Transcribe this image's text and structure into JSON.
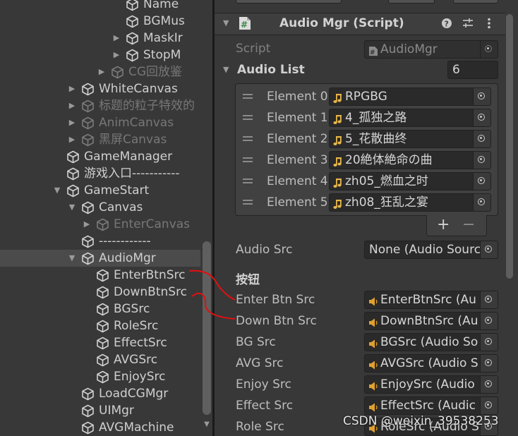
{
  "hierarchy": {
    "items": [
      {
        "label": "Name",
        "depth": 4,
        "arrow": "",
        "dim": false
      },
      {
        "label": "BGMus",
        "depth": 4,
        "arrow": "",
        "dim": false
      },
      {
        "label": "MaskIr",
        "depth": 4,
        "arrow": "right",
        "dim": false
      },
      {
        "label": "StopM",
        "depth": 4,
        "arrow": "right",
        "dim": false
      },
      {
        "label": "CG回放鉴",
        "depth": 3,
        "arrow": "right",
        "dim": true
      },
      {
        "label": "WhiteCanvas",
        "depth": 1,
        "arrow": "right",
        "dim": false
      },
      {
        "label": "标题的粒子特效的",
        "depth": 1,
        "arrow": "right",
        "dim": true
      },
      {
        "label": "AnimCanvas",
        "depth": 1,
        "arrow": "right",
        "dim": true
      },
      {
        "label": "黑屏Canvas",
        "depth": 1,
        "arrow": "right",
        "dim": true
      },
      {
        "label": "GameManager",
        "depth": 0,
        "arrow": "",
        "dim": false
      },
      {
        "label": "游戏入口-----------",
        "depth": 0,
        "arrow": "",
        "dim": false
      },
      {
        "label": "GameStart",
        "depth": 0,
        "arrow": "down",
        "dim": false
      },
      {
        "label": "Canvas",
        "depth": 1,
        "arrow": "down",
        "dim": false
      },
      {
        "label": "EnterCanvas",
        "depth": 2,
        "arrow": "right",
        "dim": true
      },
      {
        "label": "------------",
        "depth": 1,
        "arrow": "",
        "dim": false
      },
      {
        "label": "AudioMgr",
        "depth": 1,
        "arrow": "down",
        "dim": false,
        "selected": true
      },
      {
        "label": "EnterBtnSrc",
        "depth": 2,
        "arrow": "",
        "dim": false
      },
      {
        "label": "DownBtnSrc",
        "depth": 2,
        "arrow": "",
        "dim": false
      },
      {
        "label": "BGSrc",
        "depth": 2,
        "arrow": "",
        "dim": false
      },
      {
        "label": "RoleSrc",
        "depth": 2,
        "arrow": "",
        "dim": false
      },
      {
        "label": "EffectSrc",
        "depth": 2,
        "arrow": "",
        "dim": false
      },
      {
        "label": "AVGSrc",
        "depth": 2,
        "arrow": "",
        "dim": false
      },
      {
        "label": "EnjoySrc",
        "depth": 2,
        "arrow": "",
        "dim": false
      },
      {
        "label": "LoadCGMgr",
        "depth": 1,
        "arrow": "",
        "dim": false
      },
      {
        "label": "UIMgr",
        "depth": 1,
        "arrow": "",
        "dim": false
      },
      {
        "label": "AVGMachine",
        "depth": 1,
        "arrow": "",
        "dim": false
      }
    ]
  },
  "component": {
    "title": "Audio Mgr (Script)",
    "script_label": "Script",
    "script_value": "AudioMgr"
  },
  "audio_list": {
    "label": "Audio List",
    "size": "6",
    "elements": [
      {
        "label": "Element 0",
        "value": "RPGBG"
      },
      {
        "label": "Element 1",
        "value": "4_孤独之路"
      },
      {
        "label": "Element 2",
        "value": "5_花散曲终"
      },
      {
        "label": "Element 3",
        "value": "20絶体絶命の曲"
      },
      {
        "label": "Element 4",
        "value": "zh05_燃血之时"
      },
      {
        "label": "Element 5",
        "value": "zh08_狂乱之宴"
      }
    ],
    "plus": "+",
    "minus": "−"
  },
  "audio_src": {
    "label": "Audio Src",
    "value": "None (Audio Sourc"
  },
  "buttons_header": "按钮",
  "sources": [
    {
      "label": "Enter Btn Src",
      "value": "EnterBtnSrc (Au"
    },
    {
      "label": "Down Btn Src",
      "value": "DownBtnSrc (Au"
    },
    {
      "label": "BG Src",
      "value": "BGSrc (Audio So"
    },
    {
      "label": "AVG Src",
      "value": "AVGSrc (Audio S"
    },
    {
      "label": "Enjoy Src",
      "value": "EnjoySrc (Audio"
    },
    {
      "label": "Effect Src",
      "value": "EffectSrc (Audic"
    },
    {
      "label": "Role Src",
      "value": "RoleSrc (Audio S"
    }
  ],
  "watermark": "CSDN @weixin_39538253",
  "colors": {
    "panel_bg": "#383838",
    "field_bg": "#2a2a2a",
    "music_icon": "#e8b64a",
    "speaker_icon": "#e0a030",
    "annotation_red": "#e01010",
    "script_icon": "#3d8a4a"
  }
}
